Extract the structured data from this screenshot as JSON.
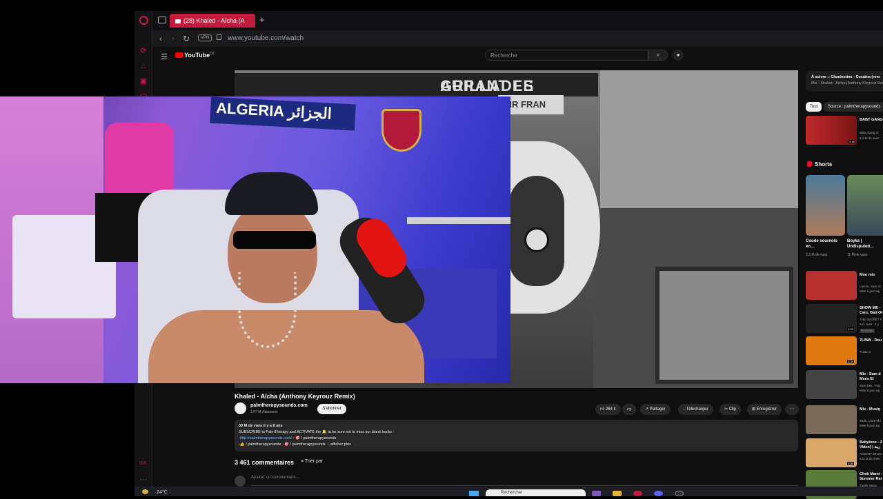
{
  "browser": {
    "tab_title": "(28) Khaled - Aïcha (A",
    "url": "www.youtube.com/watch",
    "vpn_label": "VPN",
    "gx_label": "GX"
  },
  "youtube": {
    "logo_text": "YouTube",
    "logo_region": "DZ",
    "search_placeholder": "Recherche"
  },
  "video_scene": {
    "sign_left": "AURANT LE",
    "sign_grillades": "GRILLADES",
    "sign_airfrance": "AIR FRAN"
  },
  "webcam_scene": {
    "scarf_text": "ALGERIA الجزائر"
  },
  "video": {
    "title": "Khaled - Aïcha (Anthony Keyrouz Remix)",
    "channel_name": "palmtherapysounds.com",
    "channel_subs": "1,67 M d'abonnés",
    "subscribe_label": "S'abonner",
    "likes": "264 k",
    "share_label": "Partager",
    "download_label": "Télécharger",
    "clip_label": "Clip",
    "save_label": "Enregistrer",
    "description": {
      "stats": "30 M de vues  il y a 8 ans",
      "line1": "SUBSCRIBE to PalmTherapy and ACTIVATE the 🔔 to be sure not to miss our latest tracks :",
      "link1": "-http://palmtherapysounds.com/",
      "line2_tail": "- 🎯 / palmtherapysounds",
      "line3a": "-👍 / palmtherapysounds",
      "line3b": "-🎯 / palmtherapysounds",
      "more": "...afficher plus"
    }
  },
  "comments": {
    "count": "3 461 commentaires",
    "sort_label": "Trier par",
    "add_placeholder": "Ajoutez un commentaire..."
  },
  "sidebar": {
    "upnext_title": "À suivre :: Clandestine - Cocaïna (rem",
    "upnext_sub": "Mix - Khaled - Aïcha (Anthony Keyrouz Remi",
    "chips": [
      "Tout",
      "Source : palmtherapysounds"
    ],
    "items_top": {
      "title": "BABY GANG OMEGA - KR",
      "channel": "Baby Gang ⊙",
      "meta": "5,4 M de vues",
      "duration": "3:18"
    },
    "shorts_heading": "Shorts",
    "shorts": [
      {
        "title": "Coude sournois en…",
        "views": "3,3 M de vues"
      },
      {
        "title": "Boyka | Undisputed…",
        "views": "11 M de vues"
      }
    ],
    "items": [
      {
        "title": "Mon mix",
        "channel": "Lacrim, Sam Gi",
        "meta": "Mise à jour auj",
        "duration": "",
        "color": "#b83030"
      },
      {
        "title": "SHOW ME - Cars, Bad Ol",
        "channel": "THE SECRET F",
        "meta": "521 vues · il y",
        "duration": "3:31",
        "badge": "Nouveau",
        "color": "#222222"
      },
      {
        "title": "7LIWA - Dou",
        "channel": "7Liwa ⊙",
        "meta": "",
        "duration": "3:03",
        "color": "#e07a10"
      },
      {
        "title": "Mix - Sam d Mses El Koul",
        "channel": "Sam Dex, Trap",
        "meta": "Mise à jour auj",
        "duration": "",
        "color": "#444444"
      },
      {
        "title": "Mix - Musiq",
        "channel": "Zedk, Cheb Mo",
        "meta": "Mise à jour auj",
        "duration": "",
        "color": "#7a6a5a"
      },
      {
        "title": "Babylone - Z Video) | زينة",
        "channel": "ASWATT STUD",
        "meta": "233 M de vues",
        "duration": "4:05",
        "color": "#d9a66a"
      },
      {
        "title": "Cheb Mami - Summer Rai",
        "channel": "Zaphir Music",
        "meta": "",
        "duration": "",
        "color": "#5a7a3a"
      }
    ]
  },
  "taskbar": {
    "temperature": "24°C",
    "search_placeholder": "Rechercher"
  },
  "colors": {
    "opera_red": "#c41a3c",
    "youtube_red": "#ff0000",
    "page_bg": "#0f0f0f"
  }
}
